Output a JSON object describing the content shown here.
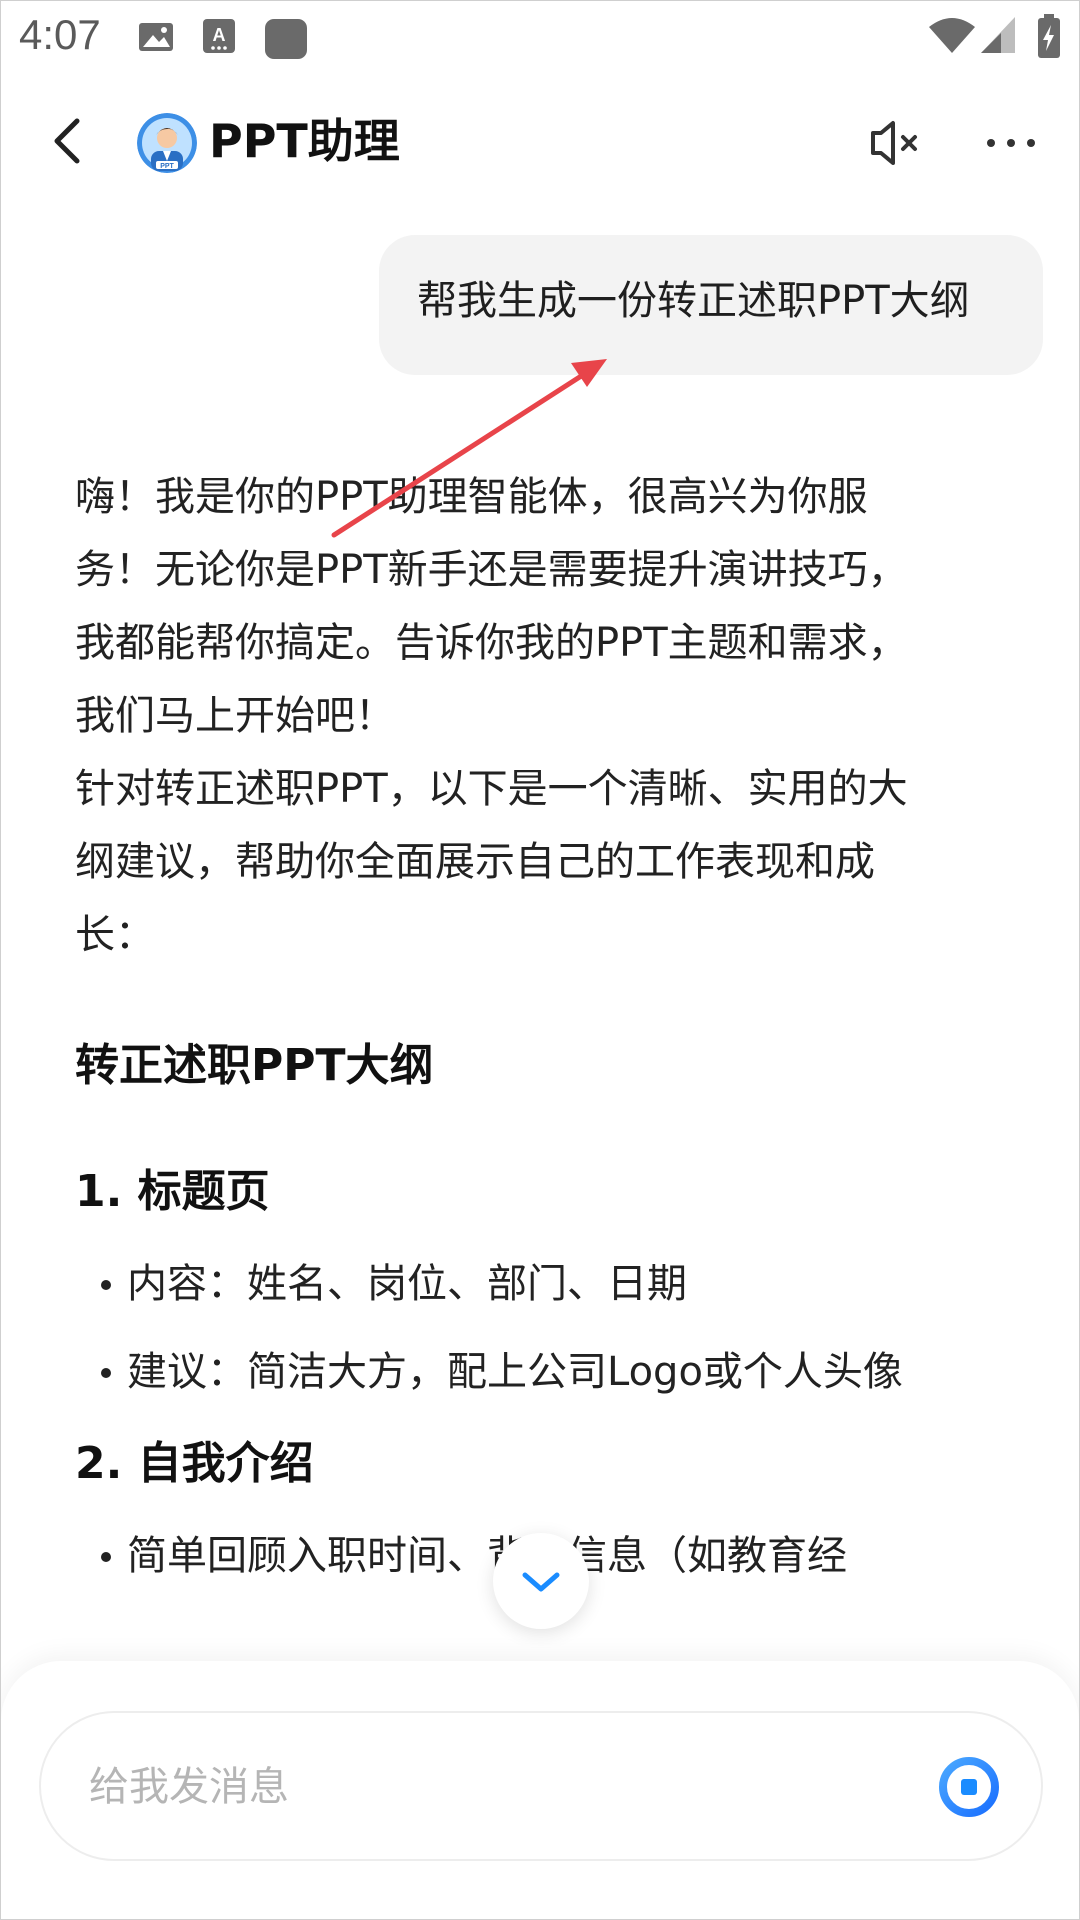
{
  "status_bar": {
    "time": "4:07",
    "icons": [
      "image-icon",
      "text-recognition-icon",
      "app-square-icon",
      "wifi-icon",
      "signal-icon",
      "battery-charging-icon"
    ]
  },
  "header": {
    "back_icon": "chevron-left-icon",
    "title": "PPT助理",
    "avatar_badge": "PPT",
    "mute_icon": "speaker-mute-icon",
    "more_icon": "more-dots-icon"
  },
  "chat": {
    "user_message": "帮我生成一份转正述职PPT大纲",
    "assistant": {
      "intro_lines": [
        "嗨！我是你的PPT助理智能体，很高兴为你服",
        "务！无论你是PPT新手还是需要提升演讲技巧，",
        "我都能帮你搞定。告诉你我的PPT主题和需求，",
        "我们马上开始吧！"
      ],
      "lead_lines": [
        "针对转正述职PPT，以下是一个清晰、实用的大",
        "纲建议，帮助你全面展示自己的工作表现和成",
        "长："
      ],
      "outline_title": "转正述职PPT大纲",
      "sections": [
        {
          "title": "1. 标题页",
          "bullets": [
            "内容：姓名、岗位、部门、日期",
            "建议：简洁大方，配上公司Logo或个人头像"
          ]
        },
        {
          "title": "2. 自我介绍",
          "bullets": [
            "简单回顾入职时间、背景信息（如教育经"
          ]
        }
      ]
    }
  },
  "scroll_down_icon": "chevron-down-icon",
  "composer": {
    "placeholder": "给我发消息",
    "voice_icon": "voice-input-icon"
  },
  "colors": {
    "accent": "#1a8cff",
    "annotation_arrow": "#e8444a",
    "bubble_bg": "#f3f3f3"
  }
}
